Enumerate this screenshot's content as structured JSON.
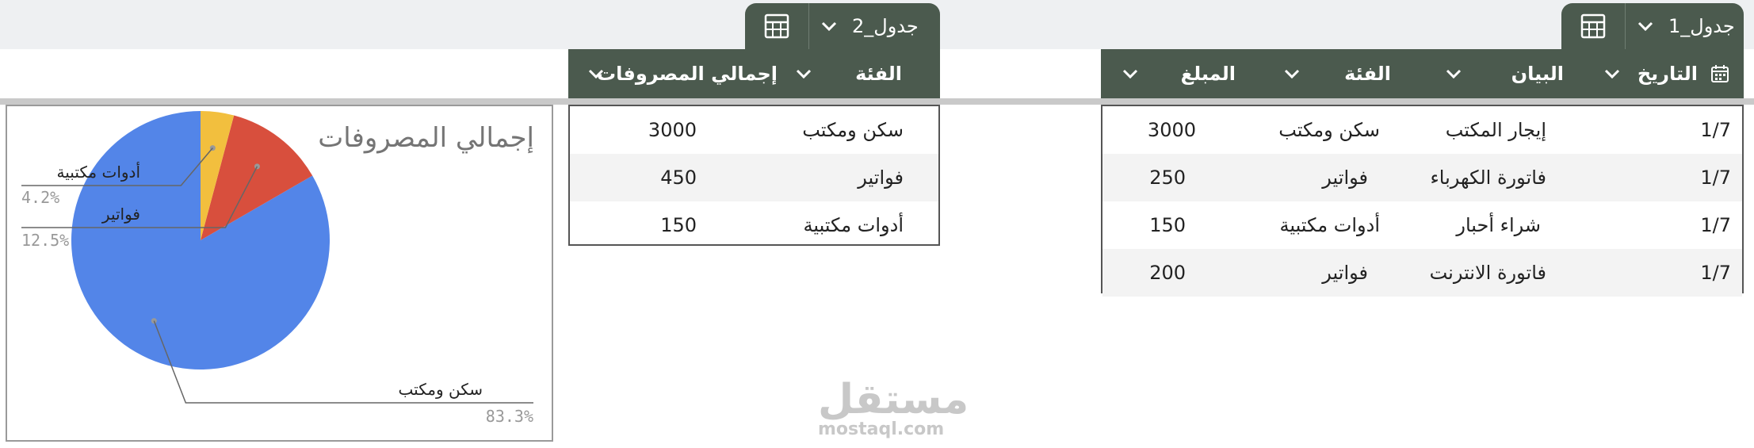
{
  "table1": {
    "tab_name": "جدول_1",
    "columns": [
      {
        "label": "التاريخ",
        "icon": "calendar-icon"
      },
      {
        "label": "البيان"
      },
      {
        "label": "الفئة"
      },
      {
        "label": "المبلغ"
      }
    ],
    "rows": [
      {
        "date": "1/7",
        "desc": "إيجار المكتب",
        "category": "سكن ومكتب",
        "amount": "3000"
      },
      {
        "date": "1/7",
        "desc": "فاتورة الكهرباء",
        "category": "فواتير",
        "amount": "250"
      },
      {
        "date": "1/7",
        "desc": "شراء أحبار",
        "category": "أدوات مكتبية",
        "amount": "150"
      },
      {
        "date": "1/7",
        "desc": "فاتورة الانترنت",
        "category": "فواتير",
        "amount": "200"
      }
    ]
  },
  "table2": {
    "tab_name": "جدول_2",
    "columns": [
      {
        "label": "الفئة"
      },
      {
        "label": "إجمالي المصروفات"
      }
    ],
    "rows": [
      {
        "category": "سكن ومكتب",
        "total": "3000"
      },
      {
        "category": "فواتير",
        "total": "450"
      },
      {
        "category": "أدوات مكتبية",
        "total": "150"
      }
    ]
  },
  "chart_data": {
    "type": "pie",
    "title": "إجمالي المصروفات",
    "categories": [
      "سكن ومكتب",
      "فواتير",
      "أدوات مكتبية"
    ],
    "values": [
      3000,
      450,
      150
    ],
    "percent_labels": [
      "83.3%",
      "12.5%",
      "4.2%"
    ],
    "colors": [
      "#5385e8",
      "#d84f3d",
      "#f2bf3e"
    ]
  },
  "watermark": {
    "arabic": "مستقل",
    "latin": "mostaql.com"
  },
  "colors": {
    "header": "#4b5a4e",
    "band": "#eef0f2"
  }
}
